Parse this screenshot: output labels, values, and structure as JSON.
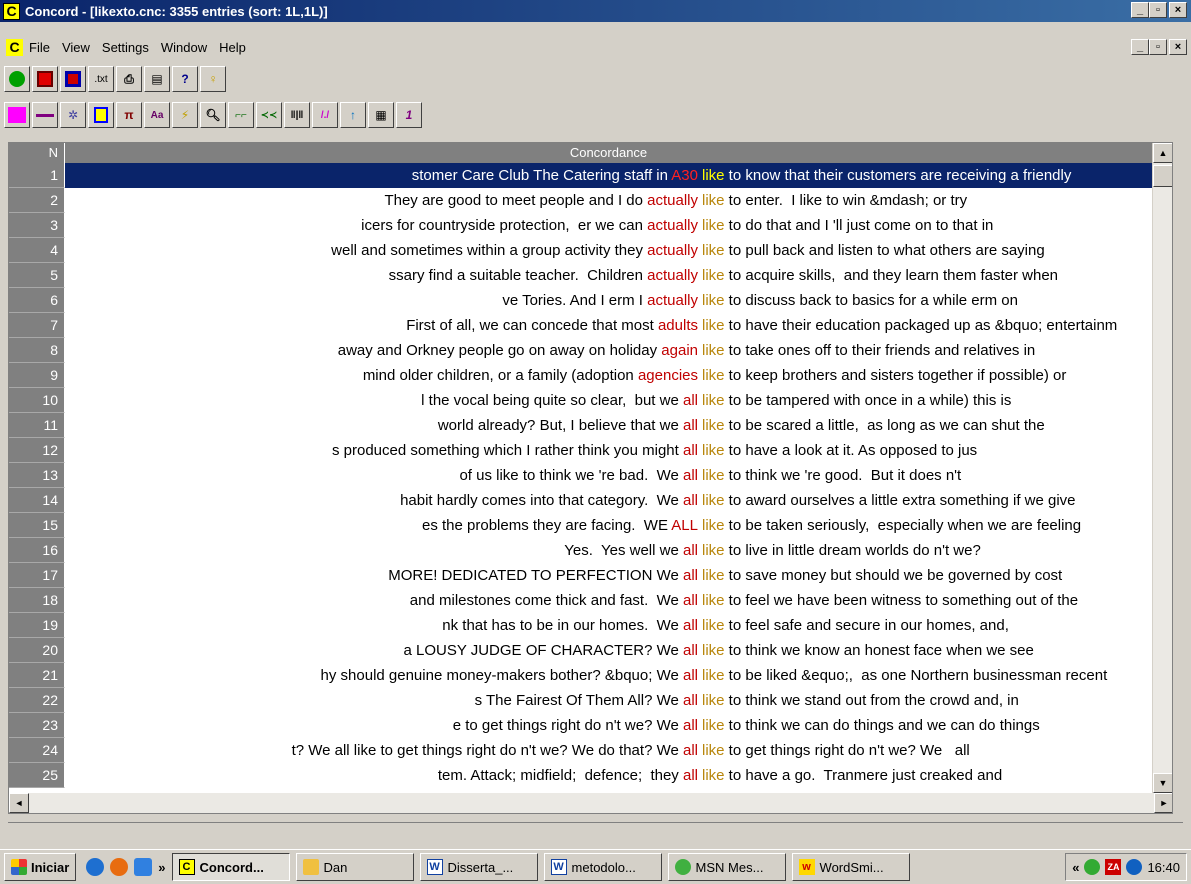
{
  "window": {
    "title": "Concord - [likexto.cnc: 3355 entries (sort: 1L,1L)]",
    "app_letter": "C"
  },
  "menu": [
    "File",
    "View",
    "Settings",
    "Window",
    "Help"
  ],
  "grid": {
    "col_n": "N",
    "col_concordance": "Concordance",
    "rows": [
      {
        "n": "1",
        "left": "stomer Care Club The Catering staff in ",
        "kw1": "A30",
        "node": "like",
        "right": " to know that their customers are receiving a friendly"
      },
      {
        "n": "2",
        "left": "They are good to meet people and I do ",
        "kw1": "actually",
        "node": "like",
        "right": " to enter.  I like to win &mdash; or try"
      },
      {
        "n": "3",
        "left": "icers for countryside protection,  er we can ",
        "kw1": "actually",
        "node": "like",
        "right": " to do that and I 'll just come on to that in"
      },
      {
        "n": "4",
        "left": "well and sometimes within a group activity they ",
        "kw1": "actually",
        "node": "like",
        "right": " to pull back and listen to what others are saying"
      },
      {
        "n": "5",
        "left": "ssary find a suitable teacher.  Children ",
        "kw1": "actually",
        "node": "like",
        "right": " to acquire skills,  and they learn them faster when"
      },
      {
        "n": "6",
        "left": "ve Tories. And I erm I ",
        "kw1": "actually",
        "node": "like",
        "right": " to discuss back to basics for a while erm on"
      },
      {
        "n": "7",
        "left": "First of all, we can concede that most ",
        "kw1": "adults",
        "node": "like",
        "right": " to have their education packaged up as &bquo; entertainm"
      },
      {
        "n": "8",
        "left": "away and Orkney people go on away on holiday ",
        "kw1": "again",
        "node": "like",
        "right": " to take ones off to their friends and relatives in"
      },
      {
        "n": "9",
        "left": "mind older children, or a family (adoption ",
        "kw1": "agencies",
        "node": "like",
        "right": " to keep brothers and sisters together if possible) or"
      },
      {
        "n": "10",
        "left": "l the vocal being quite so clear,  but we ",
        "kw1": "all",
        "node": "like",
        "right": " to be tampered with once in a while) this is"
      },
      {
        "n": "11",
        "left": "world already? But, I believe that we ",
        "kw1": "all",
        "node": "like",
        "right": " to be scared a little,  as long as we can shut the"
      },
      {
        "n": "12",
        "left": "s produced something which I rather think you might ",
        "kw1": "all",
        "node": "like",
        "right": " to have a look at it. As opposed to jus"
      },
      {
        "n": "13",
        "left": "of us like to think we 're bad.  We ",
        "kw1": "all",
        "node": "like",
        "right": " to think we 're good.  But it does n't"
      },
      {
        "n": "14",
        "left": "habit hardly comes into that category.  We ",
        "kw1": "all",
        "node": "like",
        "right": " to award ourselves a little extra something if we give"
      },
      {
        "n": "15",
        "left": "es the problems they are facing.  WE ",
        "kw1": "ALL",
        "node": "like",
        "right": " to be taken seriously,  especially when we are feeling"
      },
      {
        "n": "16",
        "left": "Yes.  Yes well we ",
        "kw1": "all",
        "node": "like",
        "right": " to live in little dream worlds do n't we?"
      },
      {
        "n": "17",
        "left": "MORE! DEDICATED TO PERFECTION We ",
        "kw1": "all",
        "node": "like",
        "right": " to save money but should we be governed by cost"
      },
      {
        "n": "18",
        "left": "and milestones come thick and fast.  We ",
        "kw1": "all",
        "node": "like",
        "right": " to feel we have been witness to something out of the"
      },
      {
        "n": "19",
        "left": "nk that has to be in our homes.  We ",
        "kw1": "all",
        "node": "like",
        "right": " to feel safe and secure in our homes, and,"
      },
      {
        "n": "20",
        "left": "a LOUSY JUDGE OF CHARACTER? We ",
        "kw1": "all",
        "node": "like",
        "right": " to think we know an honest face when we see"
      },
      {
        "n": "21",
        "left": "hy should genuine money-makers bother? &bquo; We ",
        "kw1": "all",
        "node": "like",
        "right": " to be liked &equo;,  as one Northern businessman recent"
      },
      {
        "n": "22",
        "left": "s The Fairest Of Them All? We ",
        "kw1": "all",
        "node": "like",
        "right": " to think we stand out from the crowd and, in"
      },
      {
        "n": "23",
        "left": "e to get things right do n't we? We ",
        "kw1": "all",
        "node": "like",
        "right": " to think we can do things and we can do things"
      },
      {
        "n": "24",
        "left": "t? We all like to get things right do n't we? We do that? We ",
        "kw1": "all",
        "node": "like",
        "right": " to get things right do n't we? We   all"
      },
      {
        "n": "25",
        "left": "tem. Attack; midfield;  defence;  they ",
        "kw1": "all",
        "node": "like",
        "right": " to have a go.  Tranmere just creaked and"
      }
    ]
  },
  "taskbar": {
    "start": "Iniciar",
    "overflow": "»",
    "tasks": [
      {
        "label": "Concord...",
        "icon": "concord-icon"
      },
      {
        "label": "Dan",
        "icon": "folder-icon"
      },
      {
        "label": "Disserta_...",
        "icon": "word-icon"
      },
      {
        "label": "metodolo...",
        "icon": "word-icon"
      },
      {
        "label": "MSN Mes...",
        "icon": "msn-icon"
      },
      {
        "label": "WordSmi...",
        "icon": "wordsmith-icon"
      }
    ],
    "tray_chevron": "«",
    "clock": "16:40"
  }
}
